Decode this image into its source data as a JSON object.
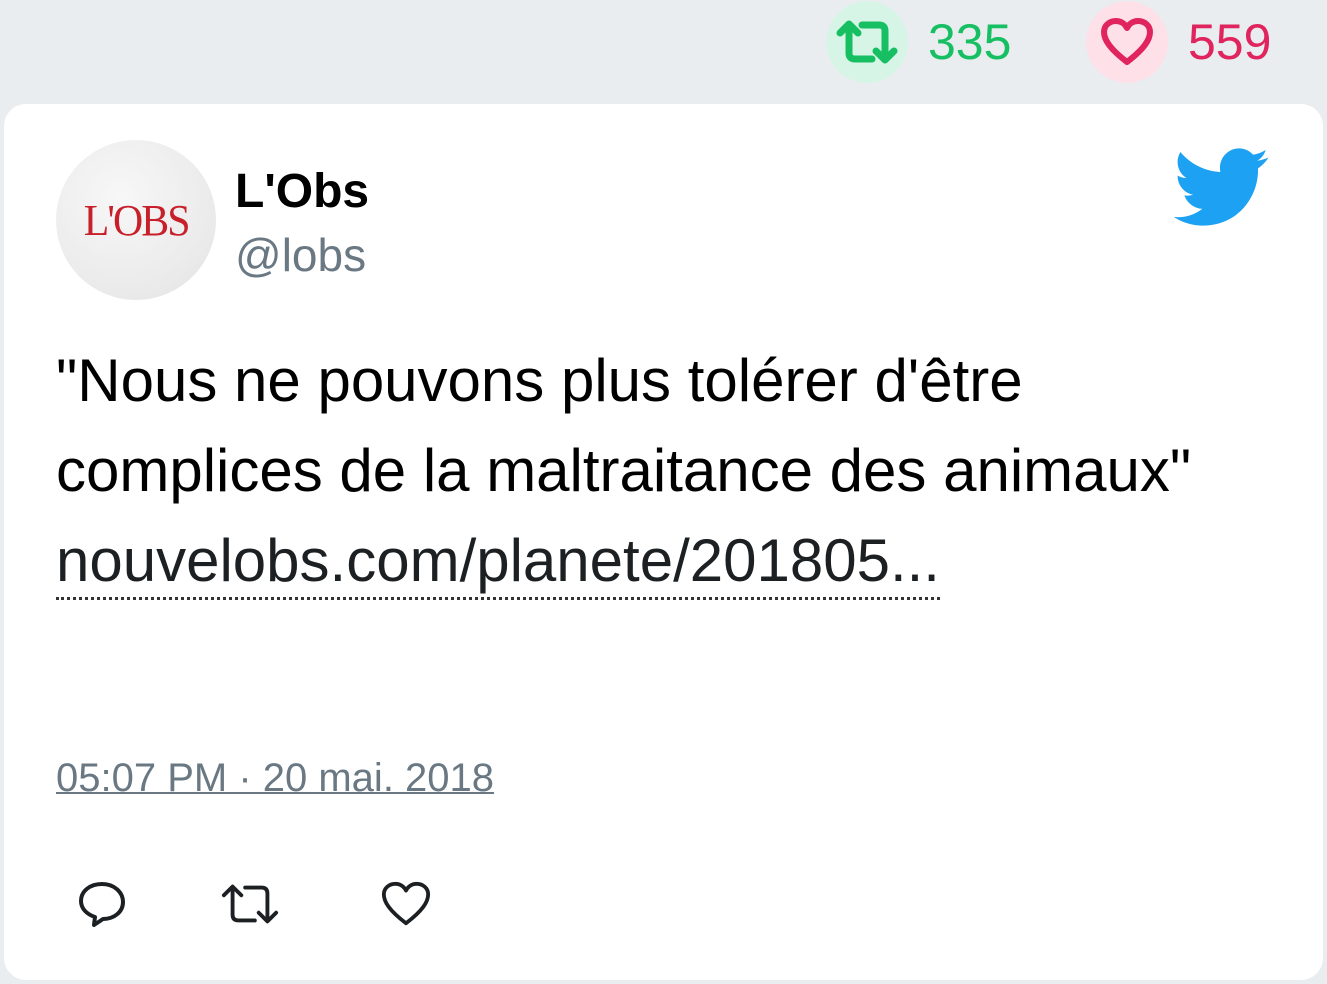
{
  "stats": {
    "retweet_count": "335",
    "like_count": "559",
    "retweet_color": "#17bf63",
    "like_color": "#e0245e"
  },
  "tweet": {
    "avatar_text": "L'OBS",
    "author_name": "L'Obs",
    "author_handle": "@lobs",
    "text": "\"Nous ne pouvons plus tolérer d'être complices de la maltraitance des animaux\"",
    "link_text": "nouvelobs.com/planete/201805...",
    "timestamp": "05:07 PM · 20 mai. 2018"
  },
  "icons": {
    "brand": "twitter-bird-icon",
    "actions": [
      "reply-icon",
      "retweet-icon",
      "like-icon"
    ]
  }
}
